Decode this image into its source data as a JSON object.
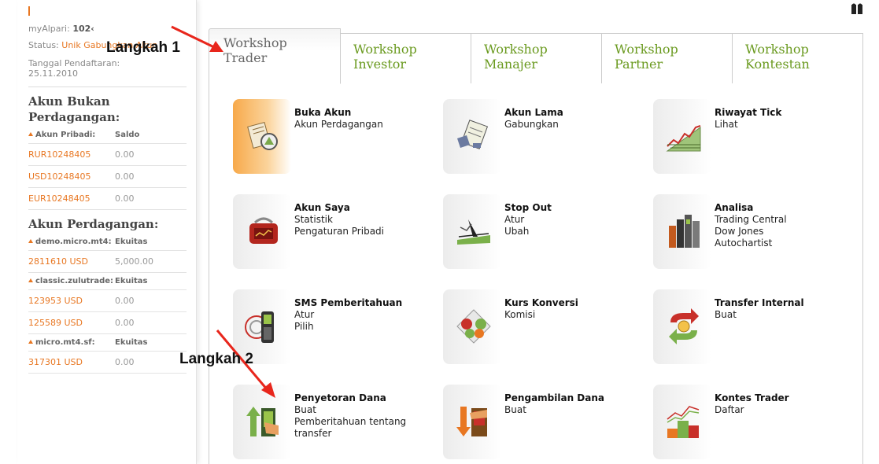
{
  "sidebar": {
    "myalpari_label": "myAlpari:",
    "myalpari_value": "102‹",
    "status_label": "Status:",
    "status_value": "Unik Gabungkan Akun",
    "reg_label": "Tanggal Pendaftaran:",
    "reg_date": "25.11.2010",
    "nontrading_title": "Akun Bukan Perdagangan:",
    "personal_header": "Akun Pribadi:",
    "balance_header": "Saldo",
    "personal_accounts": [
      {
        "name": "RUR10248405",
        "value": "0.00"
      },
      {
        "name": "USD10248405",
        "value": "0.00"
      },
      {
        "name": "EUR10248405",
        "value": "0.00"
      }
    ],
    "trading_title": "Akun Perdagangan:",
    "groups": [
      {
        "header": "demo.micro.mt4:",
        "col": "Ekuitas",
        "rows": [
          {
            "name": "2811610 USD",
            "value": "5,000.00"
          }
        ]
      },
      {
        "header": "classic.zulutrade:",
        "col": "Ekuitas",
        "rows": [
          {
            "name": "123953 USD",
            "value": "0.00"
          },
          {
            "name": "125589 USD",
            "value": "0.00"
          }
        ]
      },
      {
        "header": "micro.mt4.sf:",
        "col": "Ekuitas",
        "rows": [
          {
            "name": "317301 USD",
            "value": "0.00"
          }
        ]
      }
    ]
  },
  "tabs": [
    {
      "line1": "Workshop",
      "line2": "Trader",
      "active": true
    },
    {
      "line1": "Workshop",
      "line2": "Investor"
    },
    {
      "line1": "Workshop",
      "line2": "Manajer"
    },
    {
      "line1": "Workshop",
      "line2": "Partner"
    },
    {
      "line1": "Workshop",
      "line2": "Kontestan"
    }
  ],
  "tiles": [
    {
      "title": "Buka Akun",
      "lines": [
        "Akun Perdagangan"
      ],
      "icon": "open-account-icon"
    },
    {
      "title": "Akun Lama",
      "lines": [
        "Gabungkan"
      ],
      "icon": "old-account-icon"
    },
    {
      "title": "Riwayat Tick",
      "lines": [
        "Lihat"
      ],
      "icon": "tick-history-icon"
    },
    {
      "title": "Akun Saya",
      "lines": [
        "Statistik",
        "Pengaturan Pribadi"
      ],
      "icon": "wallet-icon"
    },
    {
      "title": "Stop Out",
      "lines": [
        "Atur",
        "Ubah"
      ],
      "icon": "stop-out-icon"
    },
    {
      "title": "Analisa",
      "lines": [
        "Trading Central",
        "Dow Jones",
        "Autochartist"
      ],
      "icon": "analysis-icon"
    },
    {
      "title": "SMS Pemberitahuan",
      "lines": [
        "Atur",
        "Pilih"
      ],
      "icon": "mobile-phone-icon"
    },
    {
      "title": "Kurs Konversi",
      "lines": [
        "Komisi"
      ],
      "icon": "currency-exchange-icon"
    },
    {
      "title": "Transfer Internal",
      "lines": [
        "Buat"
      ],
      "icon": "internal-transfer-icon"
    },
    {
      "title": "Penyetoran Dana",
      "lines": [
        "Buat",
        "Pemberitahuan tentang",
        "transfer"
      ],
      "icon": "deposit-icon"
    },
    {
      "title": "Pengambilan Dana",
      "lines": [
        "Buat"
      ],
      "icon": "withdrawal-icon"
    },
    {
      "title": "Kontes Trader",
      "lines": [
        "Daftar"
      ],
      "icon": "contest-icon"
    }
  ],
  "annotations": {
    "step1": "Langkah 1",
    "step2": "Langkah 2"
  },
  "colors": {
    "accent": "#e87722",
    "tab_text": "#6a9a1f",
    "arrow": "#e8261c"
  }
}
